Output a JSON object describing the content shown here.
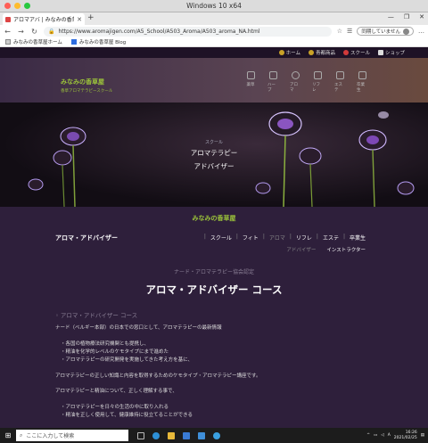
{
  "window": {
    "title": "Windows 10 x64"
  },
  "browser": {
    "tab_label": "アロマアバ | みなみの香草屋",
    "url": "https://www.aromajigen.com/A5_School/A503_Aroma/A503_aroma_NA.html",
    "sync_label": "同期していません",
    "bookmarks": [
      "みなみの香草屋ホーム",
      "みなみの香草屋 Blog"
    ]
  },
  "site": {
    "topbar": [
      "ホーム",
      "青都商品",
      "スクール",
      "ショップ"
    ],
    "topbar_colors": [
      "#c9a227",
      "#c9a227",
      "#d23a3a",
      "#dddddd"
    ],
    "logo_main": "みなみの香草屋",
    "logo_sub": "香草アロマテラピースクール",
    "header_nav": [
      "薬草",
      "ハーブ",
      "アロマ",
      "リフレ",
      "エステ",
      "卒業生"
    ],
    "hero_small": "スクール",
    "hero_title1": "アロマテラピー",
    "hero_title2": "アドバイザー",
    "sitename": "みなみの香草屋",
    "section_title": "アロマ・アドバイザー",
    "section_links": [
      "スクール",
      "フィト",
      "アロマ",
      "リフレ",
      "エステ",
      "卒業生"
    ],
    "section_sub_dim": "アドバイザー",
    "section_sub_bright": "インストラクター",
    "assoc": "ナード・アロマテラピー協会認定",
    "course_title": "アロマ・アドバイザー コース",
    "content_head": "アロマ・アドバイザー コース",
    "para1": "ナード（ベルギー本部）の日本での窓口として、アロマテラピーの最新情報",
    "list1": [
      "各国の植物療法研究機関とも提携し、",
      "精油を化学的レベルのケモタイプにまで進めた",
      "アロマテラピーの研究開発を実施してきた考え方を基に、"
    ],
    "para2": "アロマテラピーの正しい知識と内容を取得するためのケモタイプ・アロマテラピー講座です。",
    "para3": "アロマテラピーと精油について、正しく理解する事で、",
    "list2": [
      "アロマテラピーを日々の生活の中に取り入れる",
      "精油を正しく使用して、健康維持に役立てることができる"
    ]
  },
  "taskbar": {
    "search_placeholder": "ここに入力して検索",
    "time": "16:26",
    "date": "2021/02/25"
  }
}
